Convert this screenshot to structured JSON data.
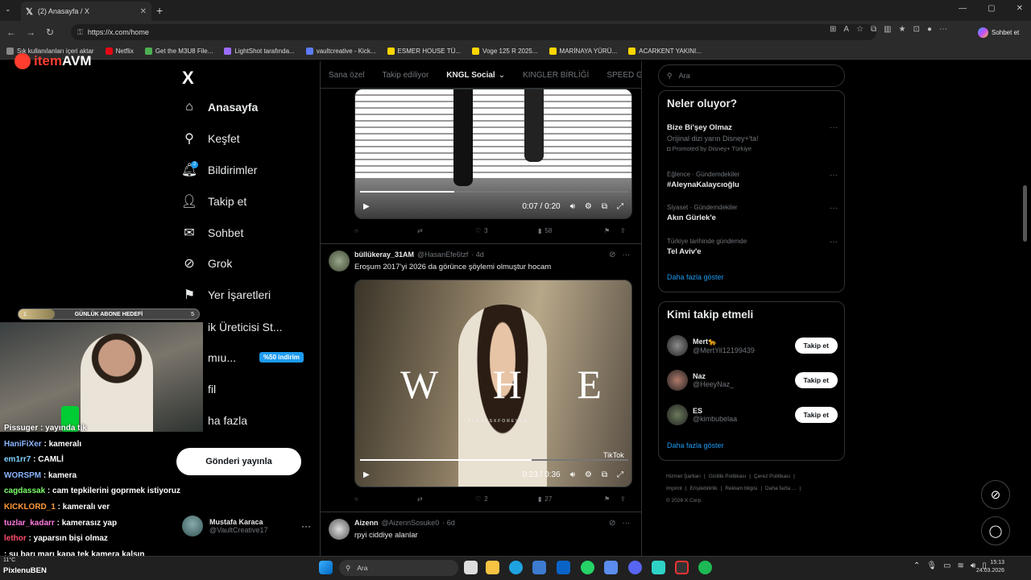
{
  "browser": {
    "tab_title": "(2) Anasayfa / X",
    "tab_close": "✕",
    "new_tab": "+",
    "url": "https://x.com/home",
    "chat_button": "Sohbet et",
    "window_controls": [
      "—",
      "▢",
      "✕"
    ],
    "bookmarks": [
      {
        "label": "Sık kullanılanları içeri aktar",
        "color": "#888888"
      },
      {
        "label": "Netflix",
        "color": "#e50914"
      },
      {
        "label": "Get the M3U8 File...",
        "color": "#4caf50"
      },
      {
        "label": "LightShot tarafında...",
        "color": "#9c6cff"
      },
      {
        "label": "vaultcreative - Kick...",
        "color": "#5c7cfa"
      },
      {
        "label": "ESMER HOUSE TÜ...",
        "color": "#ffd600"
      },
      {
        "label": "Voge 125 R 2025...",
        "color": "#ffd600"
      },
      {
        "label": "MARİNAYA YÜRÜ...",
        "color": "#ffd600"
      },
      {
        "label": "ACARKENT YAKINI...",
        "color": "#ffd600"
      }
    ]
  },
  "overlay": {
    "brand_prefix": "item",
    "brand_suffix": "AVM",
    "goal_label": "GÜNLÜK ABONE HEDEFİ",
    "goal_current": "1",
    "goal_target": "5",
    "goal_progress": 0.2,
    "chat": [
      {
        "user": "Pissuger",
        "msg": "yayında tik",
        "color": "#ffffff"
      },
      {
        "user": "HaniFiXer",
        "msg": "kameralı",
        "color": "#8ab4ff"
      },
      {
        "user": "em1rr7",
        "msg": "CAMLİ",
        "color": "#7fd0ff"
      },
      {
        "user": "WORSPM",
        "msg": "kamera",
        "color": "#8ab4ff"
      },
      {
        "user": "cagdassak",
        "msg": "cam tepkilerini goprmek istiyoruz",
        "color": "#7dff6b"
      },
      {
        "user": "KICKLORD_1",
        "msg": "kameralı ver",
        "color": "#ff9a3c"
      },
      {
        "user": "tuzlar_kadarr",
        "msg": "kamerasız yap",
        "color": "#ff7ae0"
      },
      {
        "user": "lethor",
        "msg": "yaparsın bişi olmaz",
        "color": "#ff4d6d"
      },
      {
        "user": "",
        "msg": "şu barı marı kapa tek kamera kalsın",
        "color": "#ff4d6d"
      }
    ]
  },
  "leftnav": {
    "logo": "X",
    "items": [
      {
        "label": "Anasayfa",
        "icon": "⌂"
      },
      {
        "label": "Keşfet",
        "icon": "⚲"
      },
      {
        "label": "Bildirimler",
        "icon": "🔔︎"
      },
      {
        "label": "Takip et",
        "icon": "👤︎"
      },
      {
        "label": "Sohbet",
        "icon": "✉"
      },
      {
        "label": "Grok",
        "icon": "⊘"
      },
      {
        "label": "Yer İşaretleri",
        "icon": "⚑"
      },
      {
        "label": "ik Üreticisi St...",
        "icon": ""
      },
      {
        "label": "mıu...",
        "icon": ""
      },
      {
        "label": "fil",
        "icon": ""
      },
      {
        "label": "ha fazla",
        "icon": ""
      }
    ],
    "notification_count": "2",
    "discount": "%50 indirim",
    "post_button": "Gönderi yayınla",
    "account_name": "Mustafa Karaca",
    "account_handle": "@VaultCreative17",
    "more": "···"
  },
  "timeline": {
    "tabs": [
      "Sana özel",
      "Takip ediliyor",
      "KNGL Social",
      "KINGLER BİRLİĞİ",
      "SPEED G"
    ],
    "active_tab": "KNGL Social",
    "tweets": [
      {
        "video_time": "0:07 / 0:20",
        "video_progress": 0.35,
        "likes": "3",
        "views": "58"
      },
      {
        "name": "büllükeray_31AM",
        "handle": "@HasanEfe6tzf",
        "time": "· 4d",
        "text": "Eroşum 2017'yi 2026 da görünce şöylemi olmuştur hocam",
        "video_overlay": "W H   E",
        "video_caption": "ALWAYSXFOREVER",
        "watermark": "TikTok",
        "video_time": "0:23 / 0:36",
        "video_progress": 0.64,
        "likes": "2",
        "views": "27"
      },
      {
        "name": "Aizenn",
        "handle": "@AizennSosuke0",
        "time": "· 6d",
        "text": "rpyi ciddiye alanlar"
      }
    ]
  },
  "sidebar": {
    "search_placeholder": "Ara",
    "trends_title": "Neler oluyor?",
    "trends": [
      {
        "context": "",
        "title": "Bize Bi'şey Olmaz",
        "desc": "Orijinal dizi yarın Disney+'ta!",
        "promo": "Promoted by Disney+ Türkiye"
      },
      {
        "context": "Eğlence · Gündemdekiler",
        "title": "#AleynaKalaycıoğlu"
      },
      {
        "context": "Siyaset · Gündemdekiler",
        "title": "Akın Gürlek'e"
      },
      {
        "context": "Türkiye tarihinde gündemde",
        "title": "Tel Aviv'e"
      }
    ],
    "show_more": "Daha fazla göster",
    "follow_title": "Kimi takip etmeli",
    "follow": [
      {
        "name": "Mert🐆",
        "handle": "@MertYil12199439",
        "button": "Takip et",
        "color": "#8c8c8c"
      },
      {
        "name": "Naz",
        "handle": "@HeeyNaz_",
        "button": "Takip et",
        "color": "#b07a6a"
      },
      {
        "name": "ES",
        "handle": "@kimbubelaa",
        "button": "Takip et",
        "color": "#6a7a5a"
      }
    ],
    "footer": [
      "Hizmet Şartları",
      "|",
      "Gizlilik Politikası",
      "|",
      "Çerez Politikası",
      "|",
      "Imprint",
      "|",
      "Erişilebilirlik",
      "|",
      "Reklam bilgisi",
      "|",
      "Daha fazla ...",
      "|",
      "© 2026 X Corp."
    ]
  },
  "taskbar": {
    "search": "Ara",
    "time": "15:13",
    "date": "24.03.2026",
    "weather": "11°C",
    "stream_label": "PixlenuBEN"
  }
}
